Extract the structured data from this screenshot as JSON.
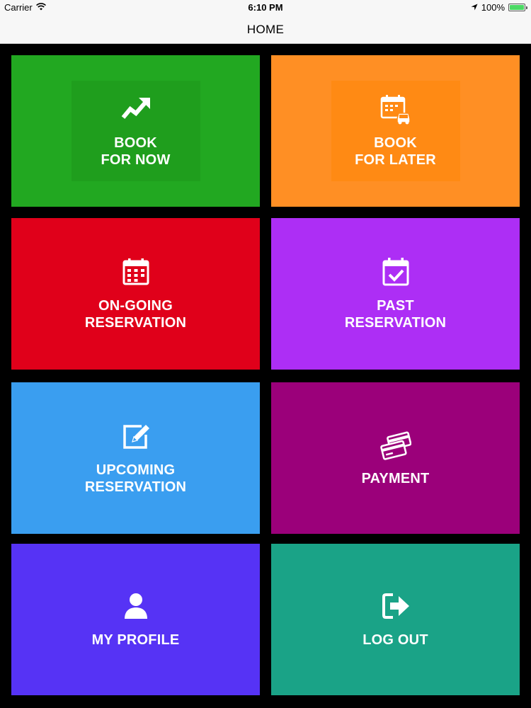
{
  "status_bar": {
    "carrier": "Carrier",
    "time": "6:10 PM",
    "battery_percent": "100%",
    "battery_level": 1.0
  },
  "nav": {
    "title": "HOME"
  },
  "tiles": [
    {
      "label": "BOOK\nFOR NOW",
      "color": "#22a821",
      "inner_color": "#1f9e1d",
      "icon": "trending-up-icon"
    },
    {
      "label": "BOOK\nFOR LATER",
      "color": "#ff8f24",
      "inner_color": "#ff8a14",
      "icon": "calendar-car-icon"
    },
    {
      "label": "ON-GOING\nRESERVATION",
      "color": "#e0001a",
      "icon": "calendar-grid-icon"
    },
    {
      "label": "PAST\nRESERVATION",
      "color": "#ad2ef5",
      "icon": "calendar-check-icon"
    },
    {
      "label": "UPCOMING\nRESERVATION",
      "color": "#3a9ef0",
      "icon": "edit-icon"
    },
    {
      "label": "PAYMENT",
      "color": "#9b007a",
      "icon": "credit-cards-icon"
    },
    {
      "label": "MY PROFILE",
      "color": "#5633f5",
      "icon": "user-icon"
    },
    {
      "label": "LOG OUT",
      "color": "#1aa387",
      "icon": "logout-icon"
    }
  ]
}
